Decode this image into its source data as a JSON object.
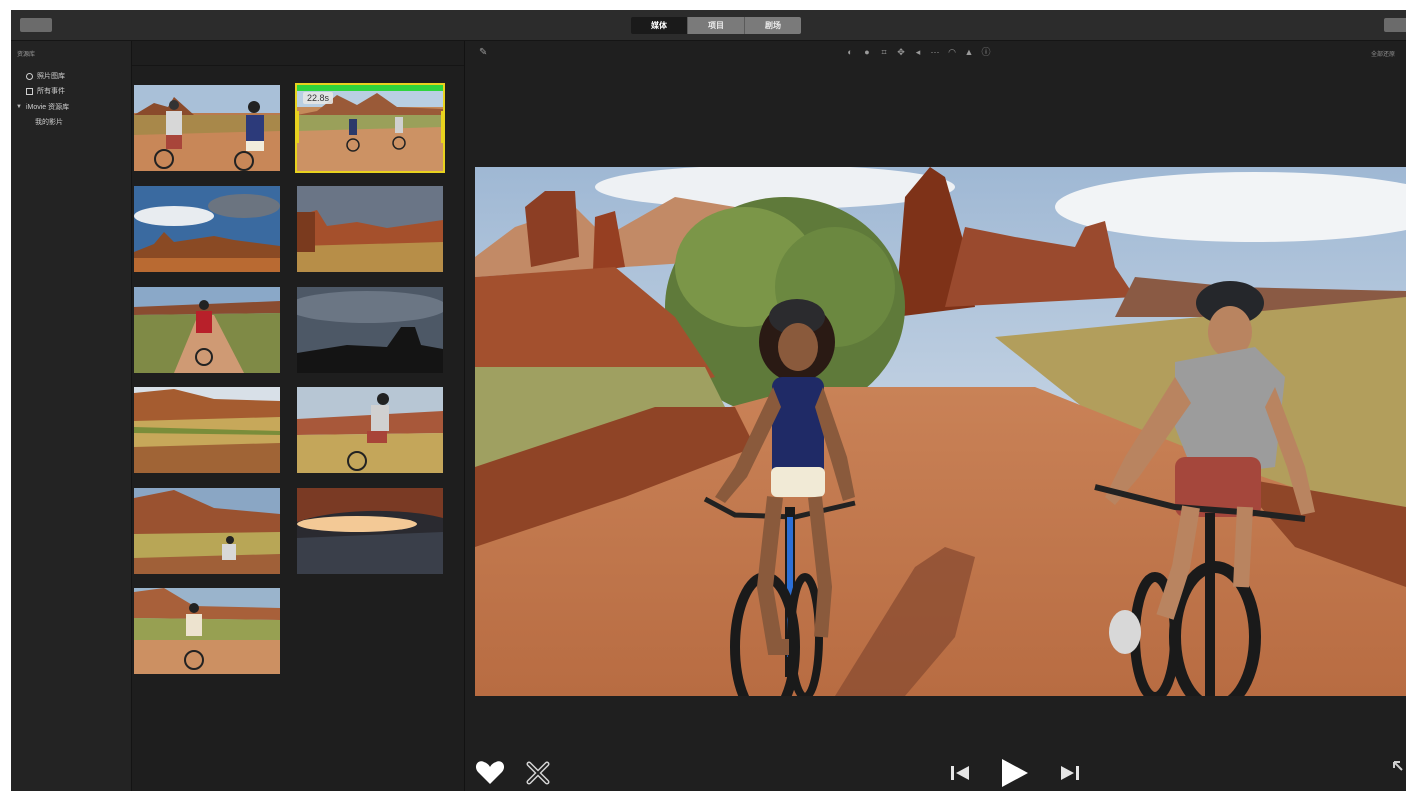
{
  "toolbar": {
    "left_button": "",
    "segments": [
      "媒体",
      "项目",
      "剧场"
    ],
    "active_segment": 0
  },
  "sidebar": {
    "header": "资源库",
    "items": [
      {
        "icon": "photo-library-icon",
        "label": "照片图库"
      },
      {
        "icon": "events-icon",
        "label": "所有事件"
      },
      {
        "icon": "disclosure-triangle-icon",
        "label": "iMovie 资源库"
      },
      {
        "icon": "",
        "label": "我的影片"
      }
    ]
  },
  "browser": {
    "selected_clip_duration": "22.8s",
    "clips": [
      {
        "scene": "two riders on dirt road"
      },
      {
        "scene": "riders in distance, selected"
      },
      {
        "scene": "desert sky with mesas"
      },
      {
        "scene": "red rock canyon"
      },
      {
        "scene": "rider on dirt road"
      },
      {
        "scene": "silhouette of butte at dusk"
      },
      {
        "scene": "desert scrub landscape"
      },
      {
        "scene": "rider passing rocks"
      },
      {
        "scene": "cyclist near red cliffs"
      },
      {
        "scene": "sunset through rock arch"
      },
      {
        "scene": "rider approaching on road"
      }
    ]
  },
  "viewer": {
    "reset_all_label": "全部还原",
    "adjust_icons": [
      "color-balance-icon",
      "color-correction-icon",
      "crop-icon",
      "stabilization-icon",
      "volume-icon",
      "noise-reduction-icon",
      "speed-icon",
      "clip-filter-icon",
      "info-icon"
    ],
    "preview_scene": "Two smiling cyclists riding mountain bikes on a dirt road through a red-rock desert"
  },
  "controls": {
    "favorite_icon": "heart-icon",
    "reject_icon": "reject-icon",
    "prev_icon": "skip-back-icon",
    "play_icon": "play-icon",
    "next_icon": "skip-forward-icon",
    "fullscreen_icon": "fullscreen-icon"
  },
  "colors": {
    "app_bg": "#1f1f1f",
    "selection": "#e8d21e",
    "range": "#2fd53d"
  }
}
